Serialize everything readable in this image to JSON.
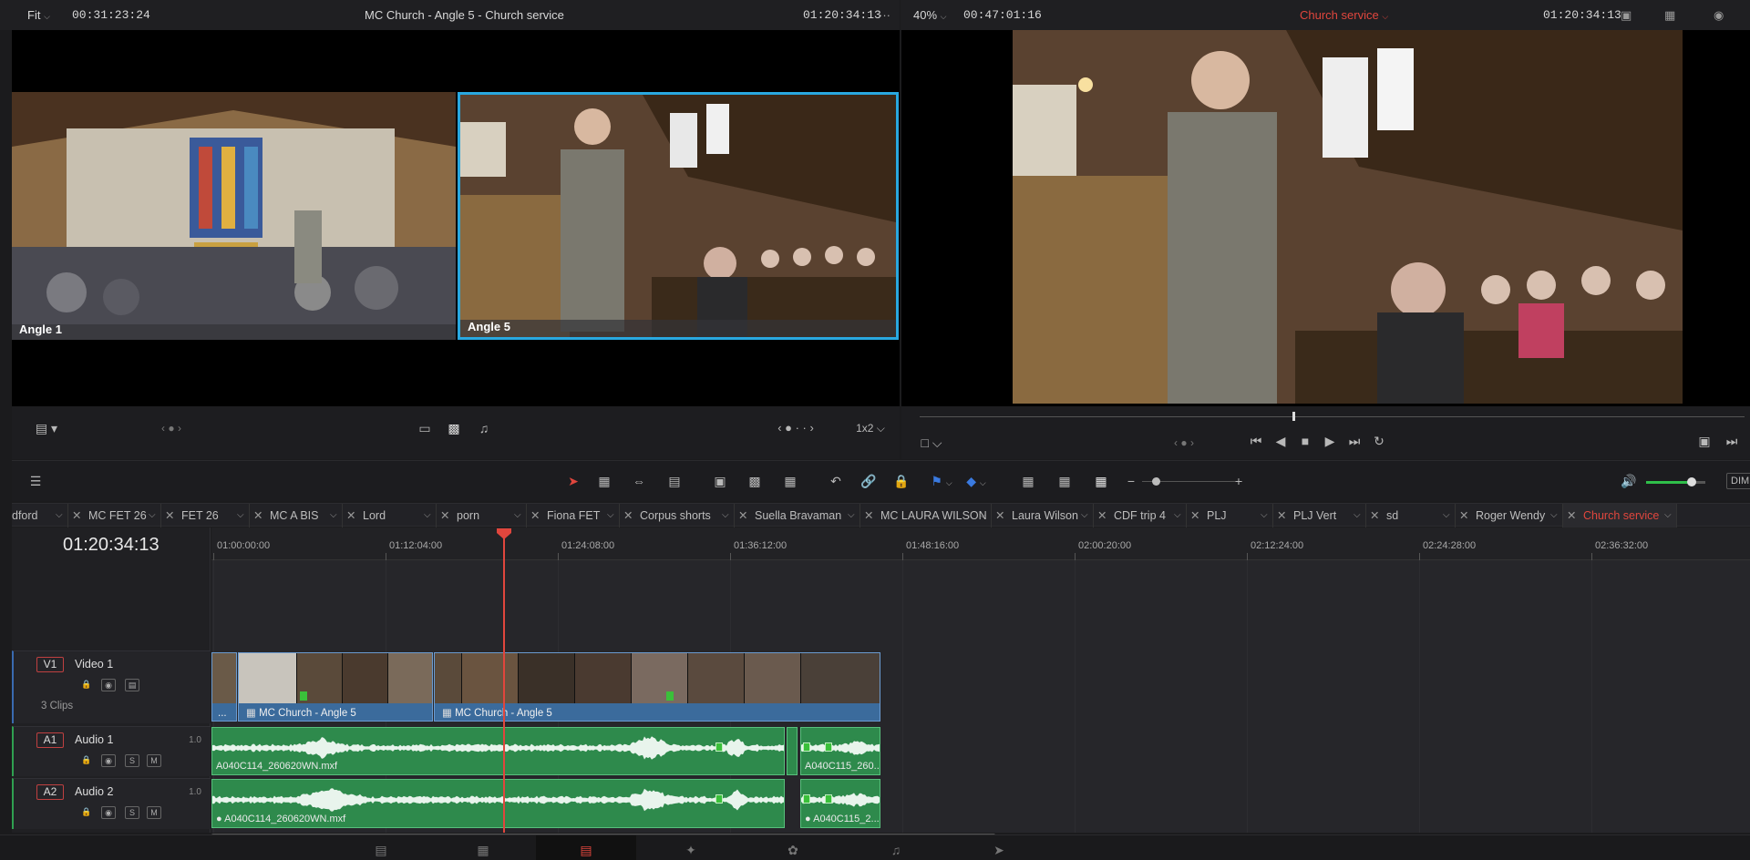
{
  "source_viewer": {
    "zoom": "Fit",
    "source_timecode": "00:31:23:24",
    "title": "MC Church - Angle 5 - Church service",
    "current_timecode": "01:20:34:13",
    "angles": [
      {
        "label": "Angle 1"
      },
      {
        "label": "Angle 5"
      }
    ],
    "layout": "1x2"
  },
  "timeline_viewer": {
    "zoom": "40%",
    "duration": "00:47:01:16",
    "timeline_name": "Church service",
    "current_timecode": "01:20:34:13"
  },
  "tabs": [
    {
      "label": "dford"
    },
    {
      "label": "MC FET 26"
    },
    {
      "label": "FET 26"
    },
    {
      "label": "MC A BIS"
    },
    {
      "label": "Lord"
    },
    {
      "label": "porn"
    },
    {
      "label": "Fiona FET"
    },
    {
      "label": "Corpus shorts"
    },
    {
      "label": "Suella Bravaman"
    },
    {
      "label": "MC LAURA WILSON"
    },
    {
      "label": "Laura Wilson"
    },
    {
      "label": "CDF trip 4"
    },
    {
      "label": "PLJ"
    },
    {
      "label": "PLJ Vert"
    },
    {
      "label": "sd"
    },
    {
      "label": "Roger Wendy"
    },
    {
      "label": "Church service",
      "active": true
    }
  ],
  "timeline": {
    "timecode": "01:20:34:13",
    "ruler": [
      "01:00:00:00",
      "01:12:04:00",
      "01:24:08:00",
      "01:36:12:00",
      "01:48:16:00",
      "02:00:20:00",
      "02:12:24:00",
      "02:24:28:00",
      "02:36:32:00"
    ],
    "tracks": {
      "v1": {
        "id": "V1",
        "name": "Video 1",
        "clip_count": "3 Clips"
      },
      "a1": {
        "id": "A1",
        "name": "Audio 1",
        "level": "1.0"
      },
      "a2": {
        "id": "A2",
        "name": "Audio 2",
        "level": "1.0"
      }
    },
    "video_clips": [
      "...",
      "MC Church - Angle 5",
      "MC Church - Angle 5"
    ],
    "audio1_clips": [
      "A040C114_260620WN.mxf",
      "A040C115_260..."
    ],
    "audio2_clips": [
      "A040C114_260620WN.mxf",
      "A040C115_2..."
    ]
  },
  "toolbar": {
    "dim_label": "DIM",
    "solo": "S",
    "mute": "M"
  },
  "colors": {
    "accent_red": "#e0463d",
    "selection_blue": "#29a8e0",
    "video_clip": "#3b6b9c",
    "audio_clip": "#2e8a4c"
  }
}
